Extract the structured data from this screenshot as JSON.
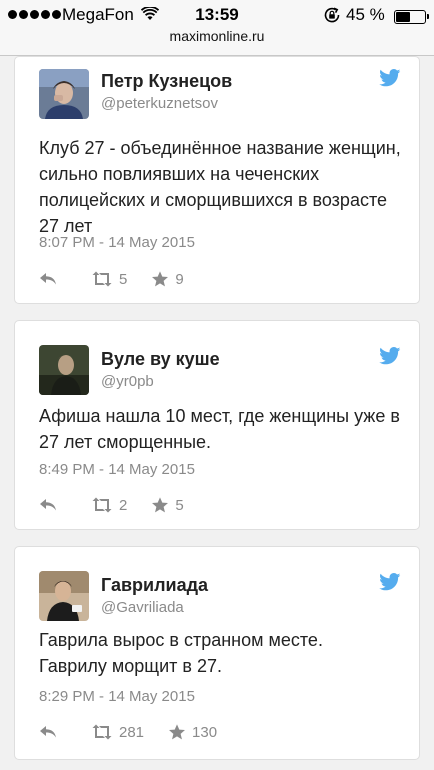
{
  "status_bar": {
    "carrier": "MegaFon",
    "time": "13:59",
    "battery_percent": "45 %",
    "battery_level": 0.45,
    "url": "maximonline.ru"
  },
  "tweets": [
    {
      "name": "Петр Кузнецов",
      "handle": "@peterkuznetsov",
      "text": "Клуб 27 -  объединённое название женщин, сильно повлиявших на чеченских полицейских и сморщившихся в возрасте 27 лет",
      "date": "8:07 PM - 14 May 2015",
      "retweets": "5",
      "favorites": "9"
    },
    {
      "name": "Вуле ву куше",
      "handle": "@yr0pb",
      "text": "Афиша нашла 10 мест, где женщины уже в 27 лет сморщенные.",
      "date": "8:49 PM - 14 May 2015",
      "retweets": "2",
      "favorites": "5"
    },
    {
      "name": "Гаврилиада",
      "handle": "@Gavriliada",
      "text": "Гаврила вырос в странном месте. Гаврилу морщит в 27.",
      "date": "8:29 PM - 14 May 2015",
      "retweets": "281",
      "favorites": "130"
    }
  ],
  "colors": {
    "twitter_blue": "#55acee",
    "muted": "#8a8a8a"
  }
}
